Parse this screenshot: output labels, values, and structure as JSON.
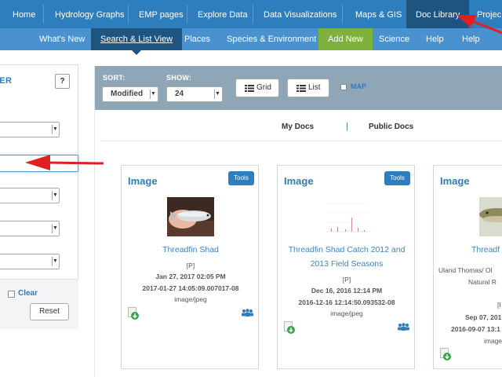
{
  "top_nav": {
    "items": [
      "Home",
      "Hydrology Graphs",
      "EMP pages",
      "Explore Data",
      "Data Visualizations",
      "Maps & GIS",
      "Doc Library",
      "Projec"
    ],
    "active": "Doc Library"
  },
  "sub_nav": {
    "items": [
      "What's New",
      "Search & List View",
      "Places",
      "Species & Environment",
      "Add New",
      "Science",
      "Help",
      "Help"
    ],
    "active": "Search & List View"
  },
  "filter_panel": {
    "title": "TER",
    "help_label": "?",
    "clear_label": "Clear",
    "reset_label": "Reset"
  },
  "toolbar": {
    "sort_label": "SORT:",
    "sort_value": "Modified",
    "show_label": "SHOW:",
    "show_value": "24",
    "grid_label": "Grid",
    "list_label": "List",
    "map_label": "MAP"
  },
  "tabs": {
    "my_docs": "My Docs",
    "separator": "|",
    "public_docs": "Public Docs"
  },
  "cards": [
    {
      "type": "Image",
      "tools": "Tools",
      "title": "Threadfin Shad",
      "tag": "[P]",
      "date": "Jan 27, 2017 02:05 PM",
      "timestamp": "2017-01-27 14:05:09.007017-08",
      "mime": "image/jpeg"
    },
    {
      "type": "Image",
      "tools": "Tools",
      "title_line1": "Threadfin Shad Catch 2012 and",
      "title_line2": "2013 Field Seasons",
      "tag": "[P]",
      "date": "Dec 16, 2016 12:14 PM",
      "timestamp": "2016-12-16 12:14:50.093532-08",
      "mime": "image/jpeg"
    },
    {
      "type": "Image",
      "title": "Threadf",
      "author_line1": "Uland Thomas/ Ol",
      "author_line2": "Natural R",
      "tag": "[I",
      "date": "Sep 07, 201",
      "timestamp": "2016-09-07 13:1",
      "mime": "image"
    }
  ],
  "colors": {
    "nav_blue": "#2e7dbd",
    "nav_active": "#1d5580",
    "subnav_blue": "#4a92cf",
    "add_new_green": "#7fb13d",
    "toolbar_gray": "#8fa6b6",
    "annotation_red": "#e02020"
  }
}
